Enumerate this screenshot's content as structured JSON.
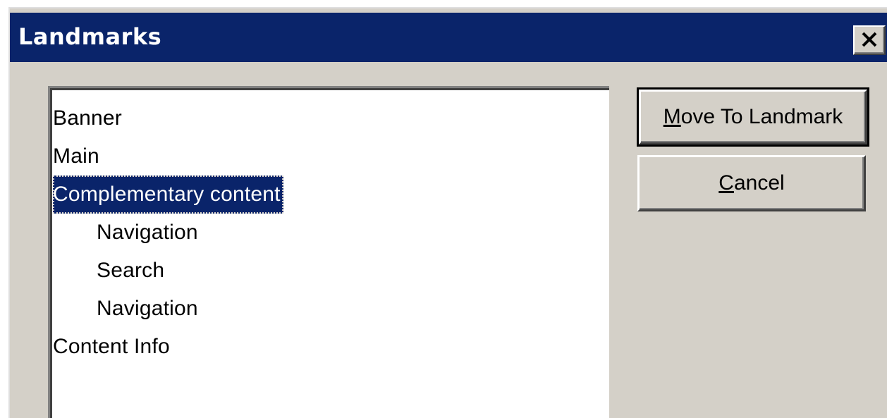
{
  "dialog": {
    "title": "Landmarks"
  },
  "close_icon": "close-x-icon",
  "landmarks_list": {
    "items": [
      {
        "label": "Banner",
        "level": 0,
        "selected": false
      },
      {
        "label": "Main",
        "level": 0,
        "selected": false
      },
      {
        "label": "Complementary content",
        "level": 0,
        "selected": true
      },
      {
        "label": "Navigation",
        "level": 1,
        "selected": false
      },
      {
        "label": "Search",
        "level": 1,
        "selected": false
      },
      {
        "label": "Navigation",
        "level": 1,
        "selected": false
      },
      {
        "label": "Content Info",
        "level": 0,
        "selected": false
      }
    ]
  },
  "buttons": {
    "move_to_landmark": {
      "mnemonic": "M",
      "rest": "ove To Landmark"
    },
    "cancel": {
      "mnemonic": "C",
      "rest": "ancel"
    }
  },
  "colors": {
    "titlebar": "#0a246a",
    "selection": "#0a246a",
    "dialog_face": "#d4d0c8"
  }
}
